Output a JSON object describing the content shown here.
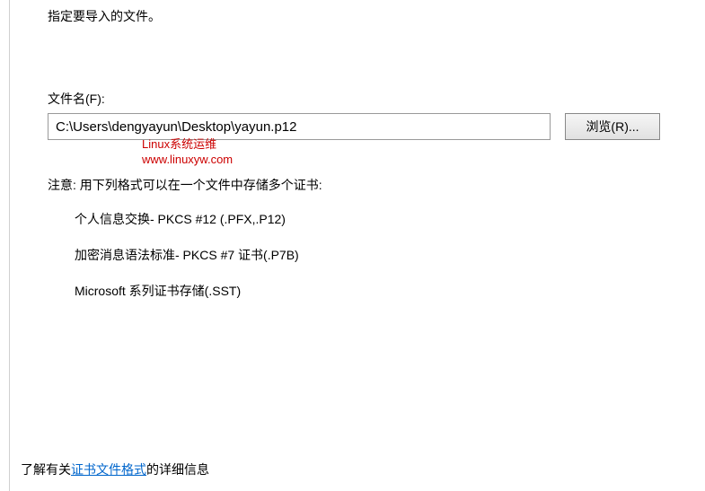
{
  "header": {
    "instruction": "指定要导入的文件。"
  },
  "file": {
    "label": "文件名(F):",
    "value": "C:\\Users\\dengyayun\\Desktop\\yayun.p12",
    "browse_label": "浏览(R)..."
  },
  "watermark": {
    "line1": "Linux系统运维",
    "line2": "www.linuxyw.com"
  },
  "note": "注意: 用下列格式可以在一个文件中存储多个证书:",
  "formats": {
    "item1": "个人信息交换- PKCS #12 (.PFX,.P12)",
    "item2": "加密消息语法标准- PKCS #7 证书(.P7B)",
    "item3": "Microsoft 系列证书存储(.SST)"
  },
  "footer": {
    "prefix": "了解有关",
    "link": "证书文件格式",
    "suffix": "的详细信息"
  }
}
